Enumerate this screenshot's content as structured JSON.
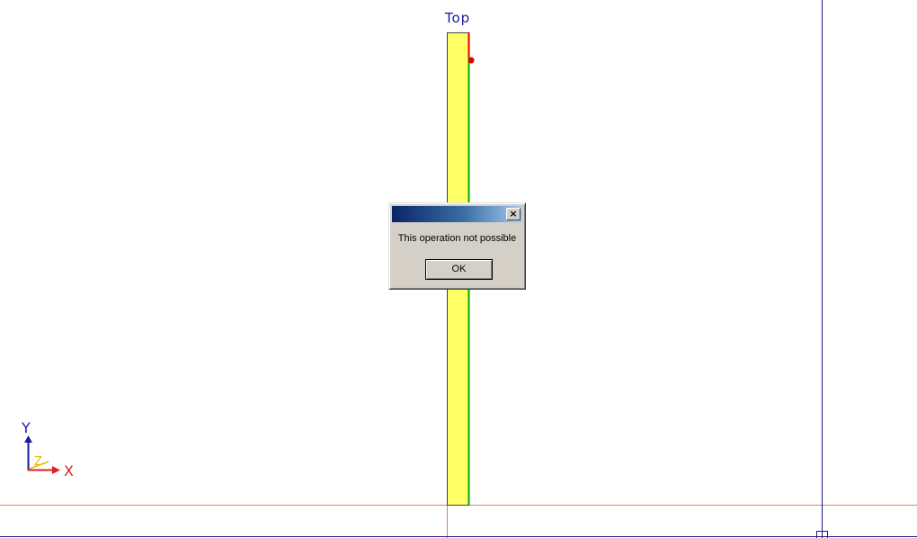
{
  "viewport": {
    "view_name": "Top",
    "background_color": "#ffffff",
    "label_color": "#1a1a9c"
  },
  "axes": {
    "x_label": "X",
    "y_label": "Y",
    "z_label": "Z",
    "x_color": "#e02020",
    "y_color": "#1a1aa0",
    "z_color": "#e0c000"
  },
  "scene": {
    "part_fill_color": "#ffff66",
    "part_outline_color": "#404040",
    "edge_green_color": "#00aa00",
    "edge_red_color": "#dd0000",
    "grid_horizontal_color": "#e08060",
    "grid_vertical_color": "#1a1a80"
  },
  "dialog": {
    "title": "",
    "close_glyph": "×",
    "message": "This operation not possible",
    "ok_label": "OK"
  }
}
